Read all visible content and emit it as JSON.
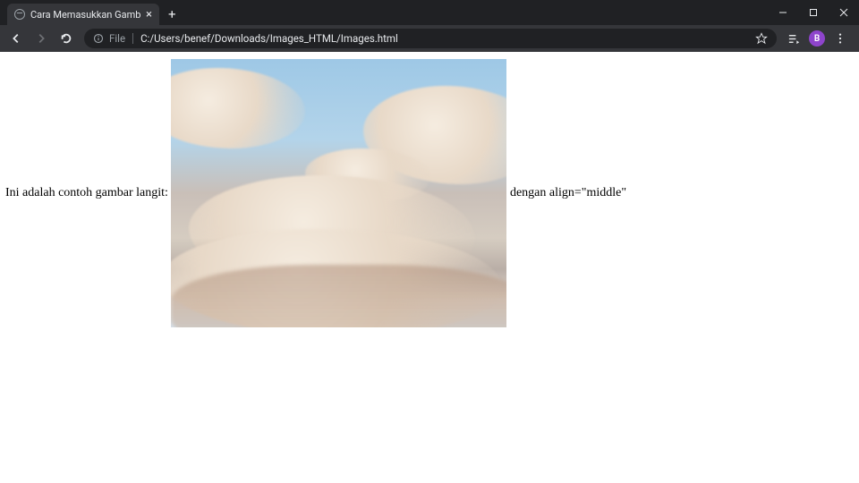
{
  "window": {
    "tab_title": "Cara Memasukkan Gambar di HT"
  },
  "addressbar": {
    "scheme_label": "File",
    "url": "C:/Users/benef/Downloads/Images_HTML/Images.html"
  },
  "profile": {
    "initial": "B"
  },
  "page": {
    "text_before": "Ini adalah contoh gambar langit: ",
    "text_after": " dengan align=\"middle\"",
    "image_alt": "sky-image"
  }
}
